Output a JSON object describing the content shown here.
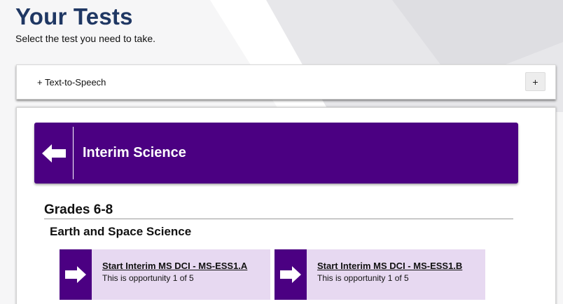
{
  "header": {
    "title": "Your Tests",
    "subtitle": "Select the test you need to take."
  },
  "tools": {
    "tts_label": "+ Text-to-Speech",
    "expand_label": "+"
  },
  "test_group": {
    "title": "Interim Science",
    "grade": "Grades 6-8",
    "subject": "Earth and Space Science",
    "tests": [
      {
        "title": "Start Interim MS DCI - MS-ESS1.A",
        "opportunity": "This is opportunity 1 of 5"
      },
      {
        "title": "Start Interim MS DCI - MS-ESS1.B",
        "opportunity": "This is opportunity 1 of 5"
      }
    ]
  },
  "colors": {
    "title": "#1f3763",
    "accent": "#4b0082",
    "card_bg": "#e7d9f1"
  }
}
